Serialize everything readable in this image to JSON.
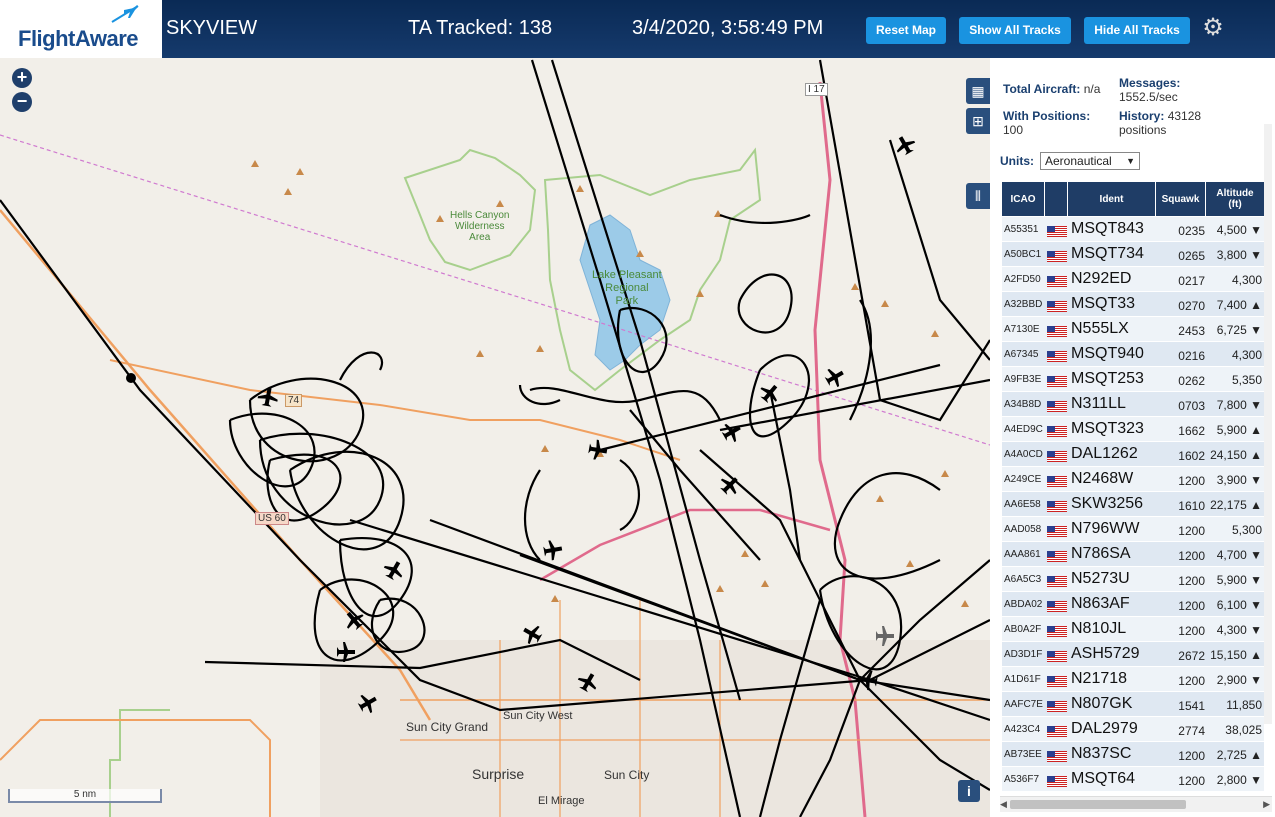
{
  "header": {
    "logo_text": "FlightAware",
    "app_name": "SKYVIEW",
    "tracked": "TA Tracked: 138",
    "datetime": "3/4/2020, 3:58:49 PM",
    "buttons": {
      "reset": "Reset Map",
      "show_all": "Show All Tracks",
      "hide_all": "Hide All Tracks"
    }
  },
  "map": {
    "zoom_in": "+",
    "zoom_out": "−",
    "scale": "5 nm",
    "info": "i",
    "labels": {
      "hells_canyon": [
        "Hells Canyon",
        "Wilderness",
        "Area"
      ],
      "lake_pleasant": [
        "Lake Pleasant",
        "Regional",
        "Park"
      ],
      "sun_city_grand": "Sun City Grand",
      "sun_city_west": "Sun City West",
      "surprise": "Surprise",
      "sun_city": "Sun City",
      "el_mirage": "El Mirage",
      "i17": "I 17",
      "us60": "US 60",
      "route_74": "74"
    }
  },
  "stats": {
    "total_aircraft_label": "Total Aircraft:",
    "total_aircraft_value": "n/a",
    "messages_label": "Messages:",
    "messages_value": "1552.5/sec",
    "with_positions_label": "With Positions:",
    "with_positions_value": "100",
    "history_label": "History:",
    "history_value_1": "43128",
    "history_value_2": "positions"
  },
  "units": {
    "label": "Units:",
    "value": "Aeronautical"
  },
  "table": {
    "headers": {
      "icao": "ICAO",
      "ident": "Ident",
      "squawk": "Squawk",
      "altitude": "Altitude",
      "altitude_unit": "(ft)"
    },
    "rows": [
      {
        "icao": "A55351",
        "ident": "MSQT843",
        "squawk": "0235",
        "alt": "4,500 ▼"
      },
      {
        "icao": "A50BC1",
        "ident": "MSQT734",
        "squawk": "0265",
        "alt": "3,800 ▼"
      },
      {
        "icao": "A2FD50",
        "ident": "N292ED",
        "squawk": "0217",
        "alt": "4,300"
      },
      {
        "icao": "A32BBD",
        "ident": "MSQT33",
        "squawk": "0270",
        "alt": "7,400 ▲"
      },
      {
        "icao": "A7130E",
        "ident": "N555LX",
        "squawk": "2453",
        "alt": "6,725 ▼"
      },
      {
        "icao": "A67345",
        "ident": "MSQT940",
        "squawk": "0216",
        "alt": "4,300"
      },
      {
        "icao": "A9FB3E",
        "ident": "MSQT253",
        "squawk": "0262",
        "alt": "5,350"
      },
      {
        "icao": "A34B8D",
        "ident": "N311LL",
        "squawk": "0703",
        "alt": "7,800 ▼"
      },
      {
        "icao": "A4ED9C",
        "ident": "MSQT323",
        "squawk": "1662",
        "alt": "5,900 ▲"
      },
      {
        "icao": "A4A0CD",
        "ident": "DAL1262",
        "squawk": "1602",
        "alt": "24,150 ▲"
      },
      {
        "icao": "A249CE",
        "ident": "N2468W",
        "squawk": "1200",
        "alt": "3,900 ▼"
      },
      {
        "icao": "AA6E58",
        "ident": "SKW3256",
        "squawk": "1610",
        "alt": "22,175 ▲"
      },
      {
        "icao": "AAD058",
        "ident": "N796WW",
        "squawk": "1200",
        "alt": "5,300"
      },
      {
        "icao": "AAA861",
        "ident": "N786SA",
        "squawk": "1200",
        "alt": "4,700 ▼"
      },
      {
        "icao": "A6A5C3",
        "ident": "N5273U",
        "squawk": "1200",
        "alt": "5,900 ▼"
      },
      {
        "icao": "ABDA02",
        "ident": "N863AF",
        "squawk": "1200",
        "alt": "6,100 ▼"
      },
      {
        "icao": "AB0A2F",
        "ident": "N810JL",
        "squawk": "1200",
        "alt": "4,300 ▼"
      },
      {
        "icao": "AD3D1F",
        "ident": "ASH5729",
        "squawk": "2672",
        "alt": "15,150 ▲"
      },
      {
        "icao": "A1D61F",
        "ident": "N21718",
        "squawk": "1200",
        "alt": "2,900 ▼"
      },
      {
        "icao": "AAFC7E",
        "ident": "N807GK",
        "squawk": "1541",
        "alt": "11,850"
      },
      {
        "icao": "A423C4",
        "ident": "DAL2979",
        "squawk": "2774",
        "alt": "38,025"
      },
      {
        "icao": "AB73EE",
        "ident": "N837SC",
        "squawk": "1200",
        "alt": "2,725 ▲"
      },
      {
        "icao": "A536F7",
        "ident": "MSQT64",
        "squawk": "1200",
        "alt": "2,800 ▼"
      }
    ]
  },
  "colors": {
    "header_bg": "#0a2a55",
    "button_blue": "#1a93e0",
    "table_head": "#1f3d66",
    "lake": "#9ccbe8",
    "track": "#000000",
    "road_orange": "#f0a060",
    "park_green": "#a8d08d"
  }
}
